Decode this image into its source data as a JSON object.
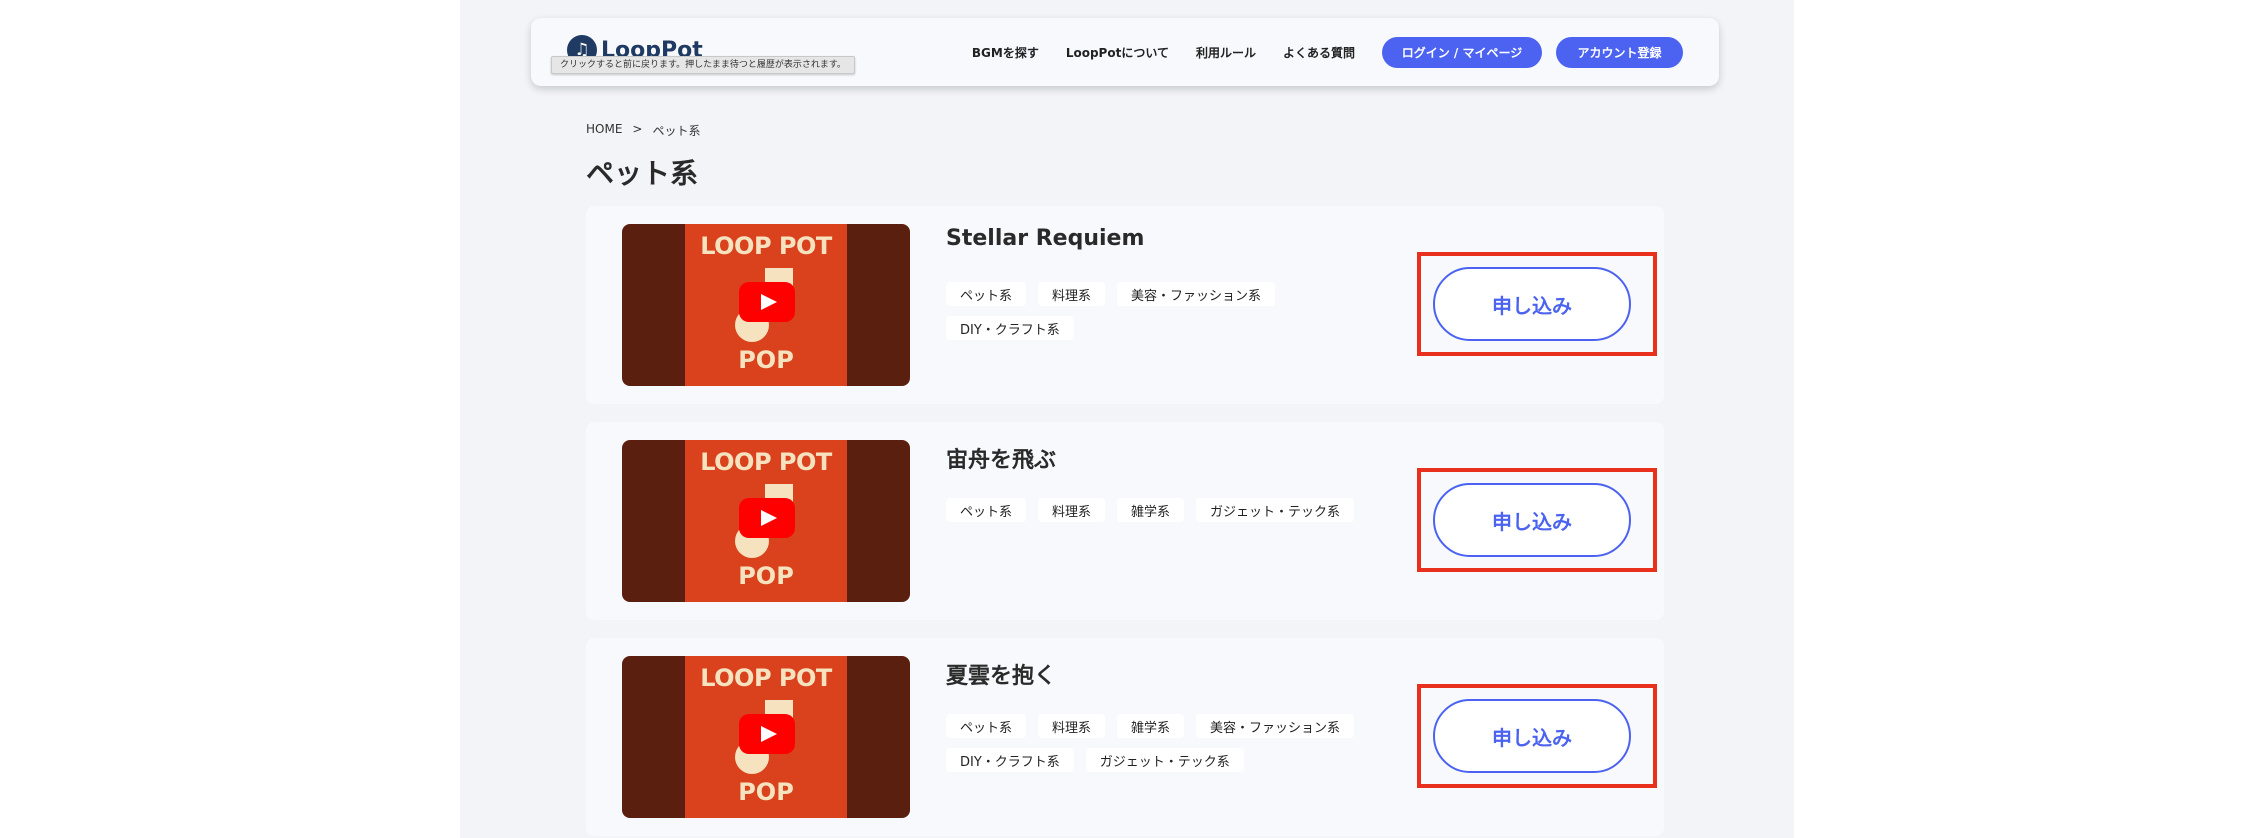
{
  "header": {
    "logo_icon": "music-note-icon",
    "logo_glyph": "♫",
    "logo_text": "LoopPot",
    "tooltip": "クリックすると前に戻ります。押したまま待つと履歴が表示されます。",
    "nav": [
      "BGMを探す",
      "LoopPotについて",
      "利用ルール",
      "よくある質問"
    ],
    "login_label": "ログイン / マイページ",
    "register_label": "アカウント登録"
  },
  "breadcrumb": {
    "home": "HOME",
    "separator": ">",
    "current": "ペット系"
  },
  "page_title": "ペット系",
  "thumbnail": {
    "top_text": "LOOP POT",
    "bottom_text": "POP",
    "play_icon": "youtube-play-icon"
  },
  "apply_label": "申し込み",
  "cards": [
    {
      "title": "Stellar Requiem",
      "tags": [
        "ペット系",
        "料理系",
        "美容・ファッション系",
        "DIY・クラフト系"
      ]
    },
    {
      "title": "宙舟を飛ぶ",
      "tags": [
        "ペット系",
        "料理系",
        "雑学系",
        "ガジェット・テック系"
      ]
    },
    {
      "title": "夏雲を抱く",
      "tags": [
        "ペット系",
        "料理系",
        "雑学系",
        "美容・ファッション系",
        "DIY・クラフト系",
        "ガジェット・テック系"
      ]
    }
  ],
  "colors": {
    "accent": "#4b63f0",
    "highlight": "#e8301c",
    "thumb_red": "#d9421c",
    "thumb_dark": "#5a1f0e"
  }
}
